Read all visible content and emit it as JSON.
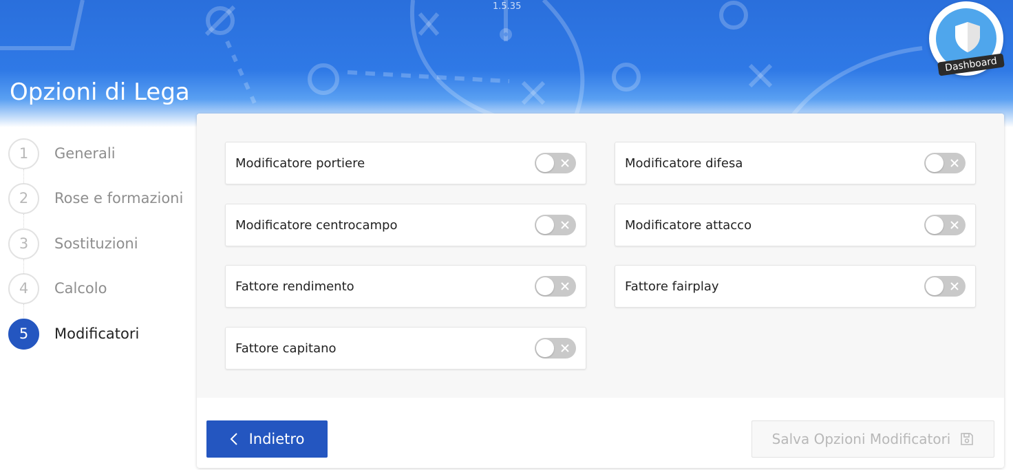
{
  "app": {
    "version": "1.5.35",
    "page_title": "Opzioni di Lega",
    "dashboard_label": "Dashboard"
  },
  "steps": [
    {
      "number": "1",
      "label": "Generali",
      "active": false
    },
    {
      "number": "2",
      "label": "Rose e formazioni",
      "active": false
    },
    {
      "number": "3",
      "label": "Sostituzioni",
      "active": false
    },
    {
      "number": "4",
      "label": "Calcolo",
      "active": false
    },
    {
      "number": "5",
      "label": "Modificatori",
      "active": true
    }
  ],
  "options": [
    {
      "label": "Modificatore portiere",
      "enabled": false
    },
    {
      "label": "Modificatore difesa",
      "enabled": false
    },
    {
      "label": "Modificatore centrocampo",
      "enabled": false
    },
    {
      "label": "Modificatore attacco",
      "enabled": false
    },
    {
      "label": "Fattore rendimento",
      "enabled": false
    },
    {
      "label": "Fattore fairplay",
      "enabled": false
    },
    {
      "label": "Fattore capitano",
      "enabled": false
    }
  ],
  "buttons": {
    "back_label": "Indietro",
    "save_label": "Salva Opzioni Modificatori",
    "save_disabled": true
  },
  "icons": {
    "back": "chevron-left-icon",
    "save": "floppy-disk-icon",
    "toggle_off": "close-icon",
    "dashboard": "shield-icon"
  },
  "colors": {
    "primary": "#2456c0",
    "banner": "#2f79e6",
    "toggle_off": "#c9c9c9"
  }
}
